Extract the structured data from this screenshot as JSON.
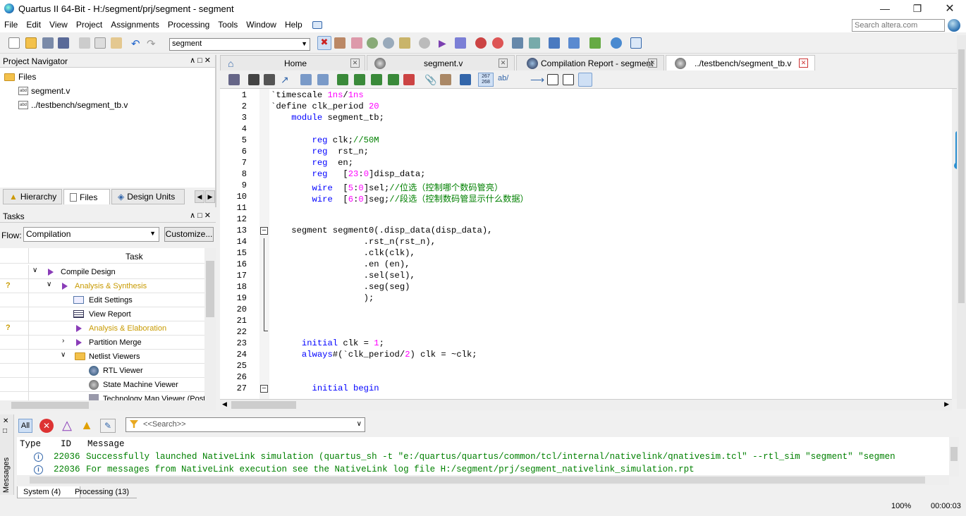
{
  "window": {
    "title": "Quartus II 64-Bit - H:/segment/prj/segment - segment"
  },
  "menus": [
    "File",
    "Edit",
    "View",
    "Project",
    "Assignments",
    "Processing",
    "Tools",
    "Window",
    "Help"
  ],
  "search": {
    "placeholder": "Search altera.com"
  },
  "toolbar": {
    "project_select": "segment"
  },
  "project_navigator": {
    "title": "Project Navigator",
    "files_root": "Files",
    "files": [
      "segment.v",
      "../testbench/segment_tb.v"
    ],
    "tabs": [
      "Hierarchy",
      "Files",
      "Design Units"
    ]
  },
  "tasks": {
    "title": "Tasks",
    "flow_label": "Flow:",
    "flow_value": "Compilation",
    "customize_label": "Customize...",
    "column_task": "Task",
    "items": [
      {
        "label": "Compile Design",
        "status": ""
      },
      {
        "label": "Analysis & Synthesis",
        "status": "?"
      },
      {
        "label": "Edit Settings",
        "status": ""
      },
      {
        "label": "View Report",
        "status": ""
      },
      {
        "label": "Analysis & Elaboration",
        "status": "?"
      },
      {
        "label": "Partition Merge",
        "status": ""
      },
      {
        "label": "Netlist Viewers",
        "status": ""
      },
      {
        "label": "RTL Viewer",
        "status": ""
      },
      {
        "label": "State Machine Viewer",
        "status": ""
      },
      {
        "label": "Technology Map Viewer (Post",
        "status": ""
      }
    ]
  },
  "doc_tabs": [
    {
      "label": "Home"
    },
    {
      "label": "segment.v"
    },
    {
      "label": "Compilation Report - segment"
    },
    {
      "label": "../testbench/segment_tb.v"
    }
  ],
  "editor": {
    "counters": "267\n268",
    "lines": [
      {
        "n": "1",
        "text": "`timescale 1ns/1ns"
      },
      {
        "n": "2",
        "text": "`define clk_period 20"
      },
      {
        "n": "3",
        "text": "    module segment_tb;"
      },
      {
        "n": "4",
        "text": ""
      },
      {
        "n": "5",
        "text": "        reg clk;//50M"
      },
      {
        "n": "6",
        "text": "        reg  rst_n;"
      },
      {
        "n": "7",
        "text": "        reg  en;"
      },
      {
        "n": "8",
        "text": "        reg   [23:0]disp_data;"
      },
      {
        "n": "9",
        "text": "        wire  [5:0]sel;//位选（控制哪个数码管亮）"
      },
      {
        "n": "10",
        "text": "        wire  [6:0]seg;//段选（控制数码管显示什么数据）"
      },
      {
        "n": "11",
        "text": ""
      },
      {
        "n": "12",
        "text": ""
      },
      {
        "n": "13",
        "text": "    segment segment0(.disp_data(disp_data),"
      },
      {
        "n": "14",
        "text": "                  .rst_n(rst_n),"
      },
      {
        "n": "15",
        "text": "                  .clk(clk),"
      },
      {
        "n": "16",
        "text": "                  .en (en),"
      },
      {
        "n": "17",
        "text": "                  .sel(sel),"
      },
      {
        "n": "18",
        "text": "                  .seg(seg)"
      },
      {
        "n": "19",
        "text": "                  );"
      },
      {
        "n": "20",
        "text": ""
      },
      {
        "n": "21",
        "text": ""
      },
      {
        "n": "22",
        "text": ""
      },
      {
        "n": "23",
        "text": "      initial clk = 1;"
      },
      {
        "n": "24",
        "text": "      always#(`clk_period/2) clk = ~clk;"
      },
      {
        "n": "25",
        "text": ""
      },
      {
        "n": "26",
        "text": ""
      },
      {
        "n": "27",
        "text": "        initial begin"
      }
    ]
  },
  "messages": {
    "filter_all": "All",
    "search_placeholder": "<<Search>>",
    "col_type": "Type",
    "col_id": "ID",
    "col_message": "Message",
    "side_label": "Messages",
    "rows": [
      {
        "id": "22036",
        "text": "Successfully launched NativeLink simulation (quartus_sh -t \"e:/quartus/quartus/common/tcl/internal/nativelink/qnativesim.tcl\" --rtl_sim \"segment\" \"segmen"
      },
      {
        "id": "22036",
        "text": "For messages from NativeLink execution see the NativeLink log file H:/segment/prj/segment_nativelink_simulation.rpt"
      }
    ],
    "tabs": [
      "System (4)",
      "Processing (13)"
    ]
  },
  "status": {
    "zoom": "100%",
    "time": "00:00:03"
  }
}
